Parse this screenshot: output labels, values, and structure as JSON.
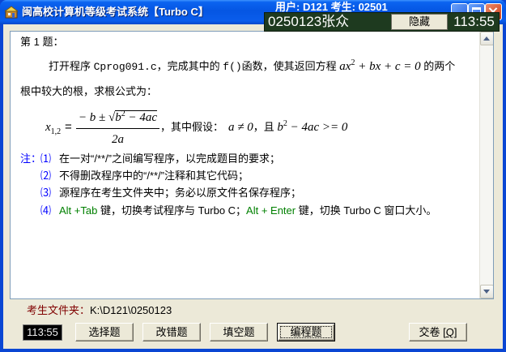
{
  "window": {
    "title": "闽高校计算机等级考试系统【Turbo C】",
    "user_info": "用户: D121  考生: 02501",
    "icons": [
      "exam-app-icon",
      "minimize-icon",
      "maximize-icon",
      "close-icon"
    ]
  },
  "overlay": {
    "candidate": "0250123张众",
    "hide_label": "隐藏",
    "timer": "113:55"
  },
  "question": {
    "heading": "第 1 题：",
    "intro": {
      "p1": "打开程序 ",
      "file": "Cprog091.c",
      "p2": "，完成其中的 ",
      "func": "f()",
      "p3": "函数，使其返回方程 ",
      "eq_lead": "ax",
      "eq_exp": "2",
      "eq_rest": " + bx + c = 0",
      "p4": " 的两个"
    },
    "line2": "根中较大的根，求根公式为：",
    "formula": {
      "var": "x",
      "sub": "1,2",
      "eq": "=",
      "num_prefix": "− b ± ",
      "sqrt_sign": "√",
      "rad_base": "b",
      "rad_exp": "2",
      "rad_rest": " − 4ac",
      "denominator": "2a",
      "cond_lead": "，其中假设：",
      "cond1": "a ≠ 0",
      "cond_join": "，且 ",
      "cond2_base": "b",
      "cond2_exp": "2",
      "cond2_rest": " − 4ac >= 0"
    }
  },
  "notes": {
    "label": "注：",
    "items": [
      {
        "num": "⑴",
        "text": "在一对“/**/”之间编写程序，以完成题目的要求；"
      },
      {
        "num": "⑵",
        "text": "不得删改程序中的“/**/”注释和其它代码；"
      },
      {
        "num": "⑶",
        "text": "源程序在考生文件夹中；务必以原文件名保存程序；"
      },
      {
        "num": "⑷",
        "key1": "Alt +Tab",
        "text1": " 键，切换考试程序与 Turbo C；",
        "key2": "Alt + Enter",
        "text2": " 键，切换 Turbo C 窗口大小。"
      }
    ]
  },
  "scrollbar": {
    "up_icon": "scroll-up-icon",
    "down_icon": "scroll-down-icon"
  },
  "footer": {
    "folder_label": "考生文件夹：",
    "folder_path": "K:\\D121\\0250123",
    "timer": "113:55",
    "tabs": [
      {
        "label": "选择题",
        "active": false
      },
      {
        "label": "改错题",
        "active": false
      },
      {
        "label": "填空题",
        "active": false
      },
      {
        "label": "编程题",
        "active": true
      }
    ],
    "submit": {
      "prefix": "交卷 [",
      "key": "Q",
      "suffix": "]"
    }
  },
  "colors": {
    "note_blue": "#0000FF",
    "hotkey_green": "#008000",
    "folder_label": "#800000",
    "overlay_bg": "#1E3A1F"
  }
}
